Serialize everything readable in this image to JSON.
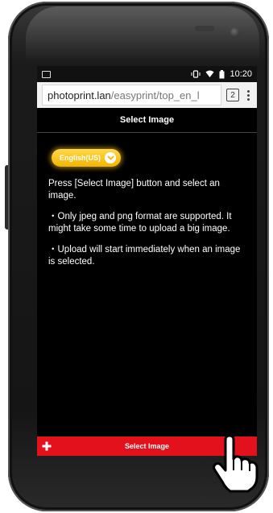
{
  "status_bar": {
    "time": "10:20"
  },
  "browser": {
    "url_host": "photoprint.lan",
    "url_path": "/easyprint/top_en_l",
    "tab_count": "2"
  },
  "page": {
    "title": "Select Image",
    "language_button": "English(US)",
    "instructions": [
      "Press [Select Image] button and select an image.",
      "・Only jpeg and png format are supported. It might take some time to upload a big image.",
      "・Upload will start immediately when an image is selected."
    ],
    "select_button": "Select Image"
  },
  "colors": {
    "accent_red": "#e3111b",
    "lang_yellow": "#f4b400"
  }
}
